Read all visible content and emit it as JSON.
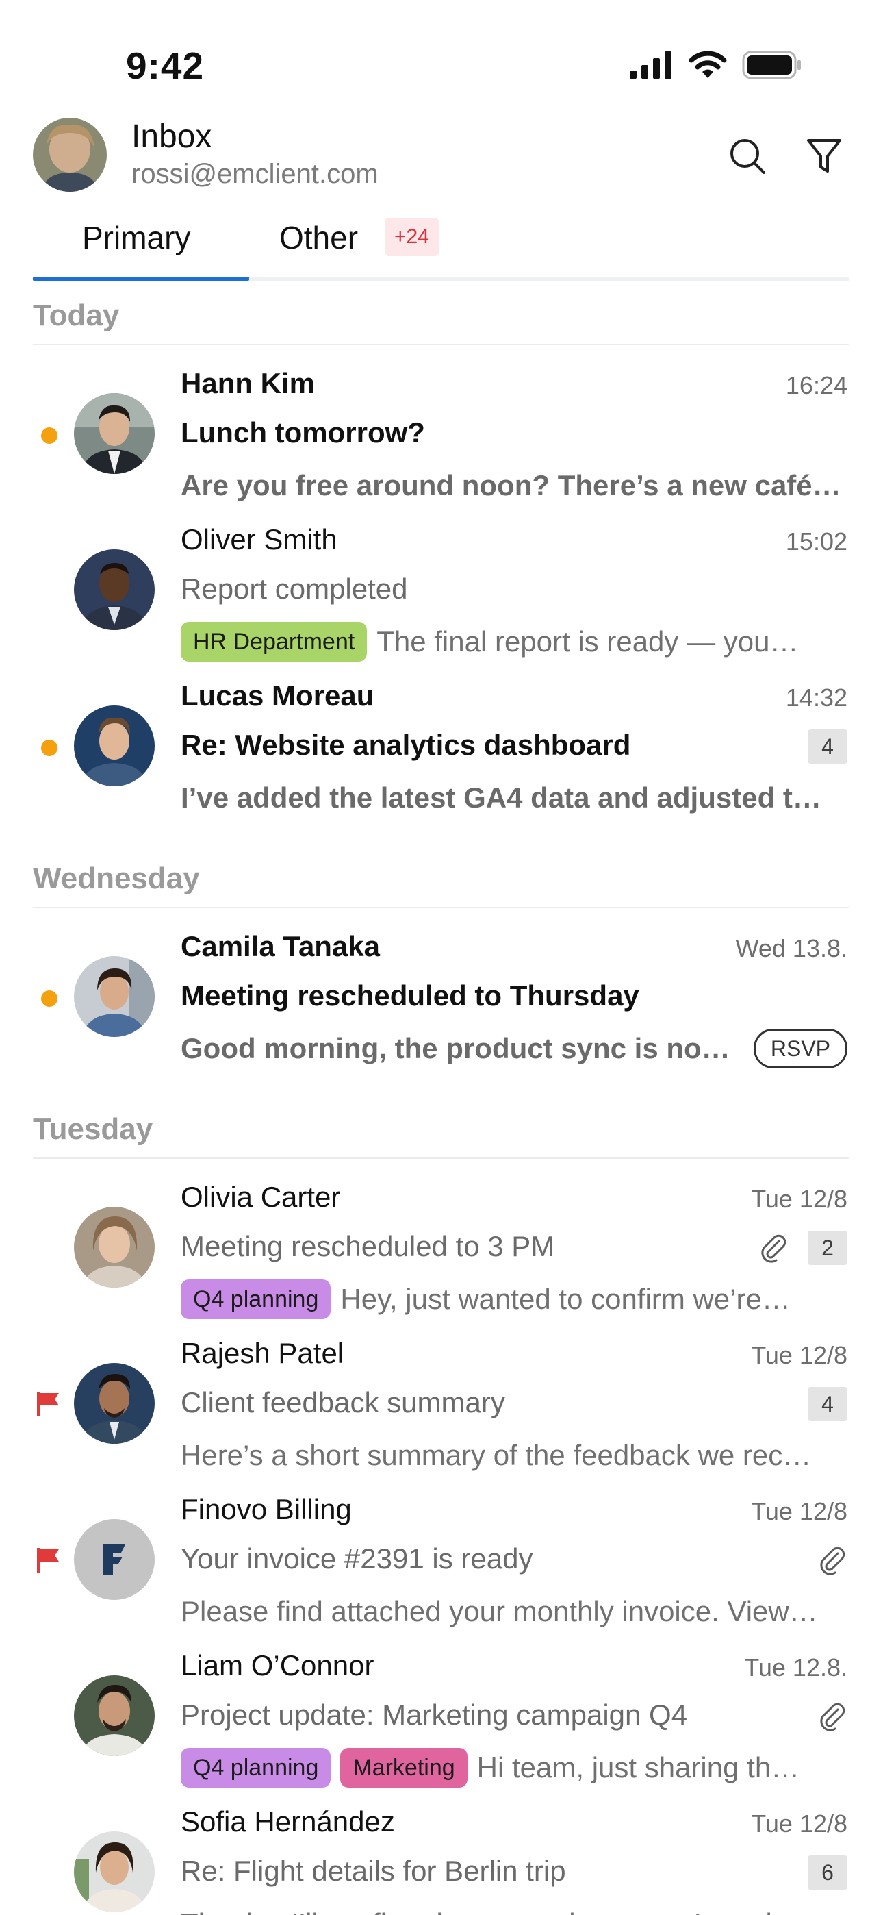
{
  "status_bar": {
    "time": "9:42"
  },
  "header": {
    "title": "Inbox",
    "email": "rossi@emclient.com"
  },
  "tabs": [
    {
      "label": "Primary",
      "active": true
    },
    {
      "label": "Other",
      "badge": "+24"
    }
  ],
  "sections": [
    {
      "label": "Today",
      "mails": [
        {
          "sender": "Hann Kim",
          "time": "16:24",
          "subject": "Lunch tomorrow?",
          "preview": "Are you free around noon? There’s a new café…",
          "unread": true
        },
        {
          "sender": "Oliver Smith",
          "time": "15:02",
          "subject": "Report completed",
          "tags": [
            "HR Department"
          ],
          "preview": "The final report is ready — you…"
        },
        {
          "sender": "Lucas Moreau",
          "time": "14:32",
          "subject": "Re: Website analytics dashboard",
          "preview": "I’ve added the latest GA4 data and adjusted t…",
          "unread": true,
          "count": "4"
        }
      ]
    },
    {
      "label": "Wednesday",
      "mails": [
        {
          "sender": "Camila Tanaka",
          "time": "Wed 13.8.",
          "subject": "Meeting rescheduled to Thursday",
          "preview": "Good morning, the product sync is no…",
          "unread": true,
          "rsvp": "RSVP"
        }
      ]
    },
    {
      "label": "Tuesday",
      "mails": [
        {
          "sender": "Olivia Carter",
          "time": "Tue 12/8",
          "subject": "Meeting rescheduled to 3 PM",
          "tags": [
            "Q4 planning"
          ],
          "preview": "Hey, just wanted to confirm we’re…",
          "attachment": true,
          "count": "2"
        },
        {
          "sender": "Rajesh Patel",
          "time": "Tue 12/8",
          "subject": "Client feedback summary",
          "preview": "Here’s a short summary of the feedback we rec…",
          "flagged": true,
          "count": "4"
        },
        {
          "sender": "Finovo Billing",
          "time": "Tue 12/8",
          "subject": "Your invoice #2391 is ready",
          "preview": "Please find attached your monthly invoice. View…",
          "flagged": true,
          "attachment": true,
          "avatar_letter": "F"
        },
        {
          "sender": "Liam O’Connor",
          "time": "Tue 12.8.",
          "subject": "Project update: Marketing campaign Q4",
          "tags": [
            "Q4 planning",
            "Marketing"
          ],
          "preview": "Hi team, just sharing th…",
          "attachment": true
        },
        {
          "sender": "Sofia Hernández",
          "time": "Tue 12/8",
          "subject": "Re: Flight details for Berlin trip",
          "preview": "Thanks, I’ll confirm the return date once I get the…",
          "count": "6"
        }
      ]
    }
  ],
  "colors": {
    "accent": "#1c6fd3",
    "unread_dot": "#f5a00e",
    "flag": "#e03a3a",
    "tag_hr": "#a8d468",
    "tag_q4": "#c98ce6",
    "tag_marketing": "#e0659e",
    "badge_other_bg": "#fde7e8",
    "badge_other_text": "#d6323c"
  }
}
